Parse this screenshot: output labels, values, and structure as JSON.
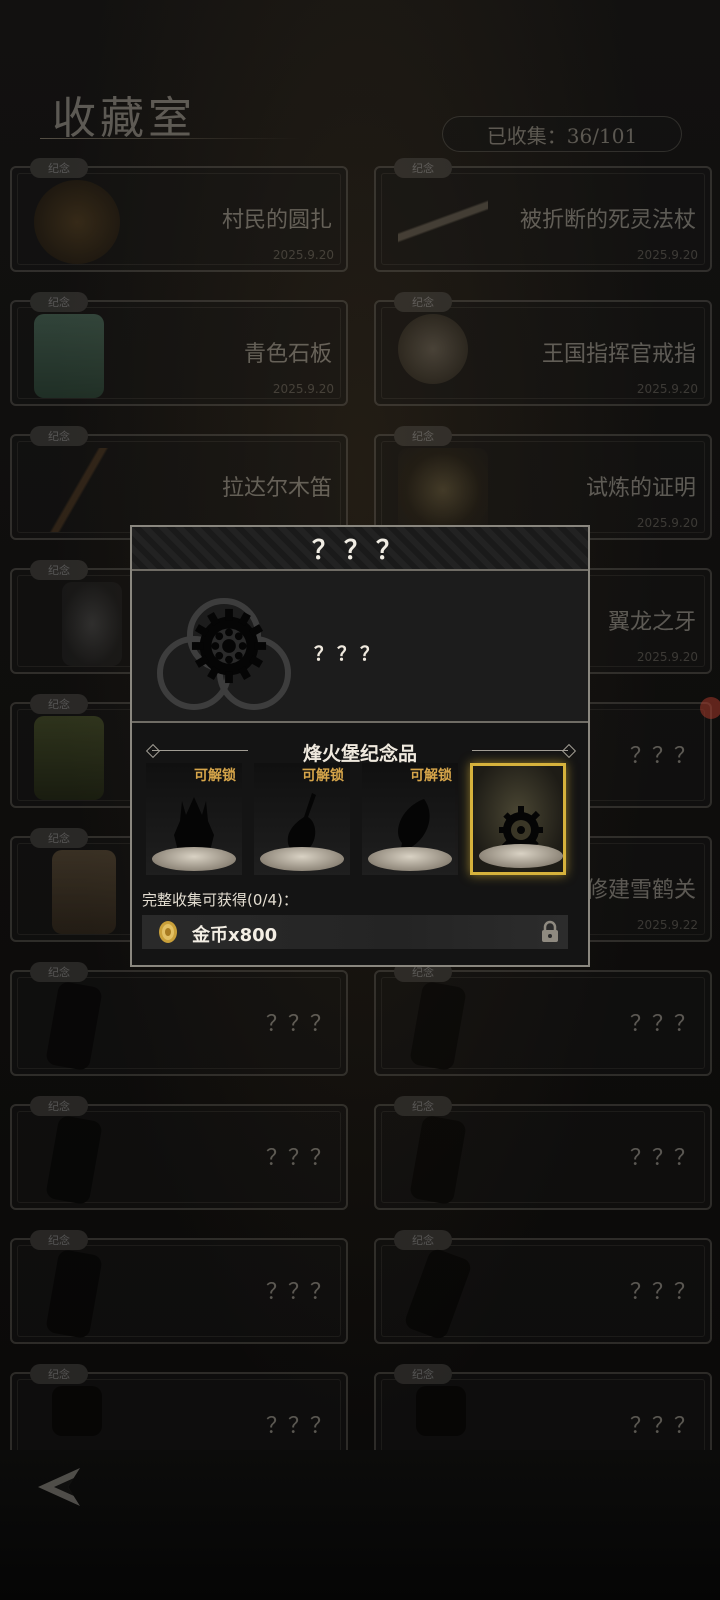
{
  "header": {
    "title": "收藏室",
    "progress": "已收集：36/101"
  },
  "collection": {
    "badge_label": "纪念",
    "cards": [
      {
        "name": "村民的圆扎",
        "date": "2025.9.20"
      },
      {
        "name": "被折断的死灵法杖",
        "date": "2025.9.20"
      },
      {
        "name": "青色石板",
        "date": "2025.9.20"
      },
      {
        "name": "王国指挥官戒指",
        "date": "2025.9.20"
      },
      {
        "name": "拉达尔木笛",
        "date": ""
      },
      {
        "name": "试炼的证明",
        "date": "2025.9.20"
      },
      {
        "name": "",
        "date": ""
      },
      {
        "name": "翼龙之牙",
        "date": "2025.9.20"
      },
      {
        "name": "",
        "date": ""
      },
      {
        "name": "？？？",
        "date": ""
      },
      {
        "name": "",
        "date": ""
      },
      {
        "name": "修建雪鹤关",
        "date": "2025.9.22"
      },
      {
        "name": "？？？",
        "date": ""
      },
      {
        "name": "？？？",
        "date": ""
      },
      {
        "name": "？？？",
        "date": ""
      },
      {
        "name": "？？？",
        "date": ""
      },
      {
        "name": "？？？",
        "date": ""
      },
      {
        "name": "？？？",
        "date": ""
      },
      {
        "name": "？？？",
        "date": ""
      },
      {
        "name": "？？？",
        "date": ""
      }
    ]
  },
  "modal": {
    "title": "？？？",
    "item_name": "？？？",
    "set_title": "烽火堡纪念品",
    "slots": [
      {
        "label": "可解锁",
        "icon": "crown-silhouette-icon"
      },
      {
        "label": "可解锁",
        "icon": "flask-silhouette-icon"
      },
      {
        "label": "可解锁",
        "icon": "leaf-silhouette-icon"
      },
      {
        "label": "",
        "icon": "gear-icon",
        "selected": true
      }
    ],
    "reward_label": "完整收集可获得(0/4)：",
    "reward_text": "金币x800",
    "reward_icon": "coin-icon",
    "reward_locked": true
  },
  "colors": {
    "accent_gold": "#d6a54a",
    "highlight_border": "#d6b23c"
  }
}
